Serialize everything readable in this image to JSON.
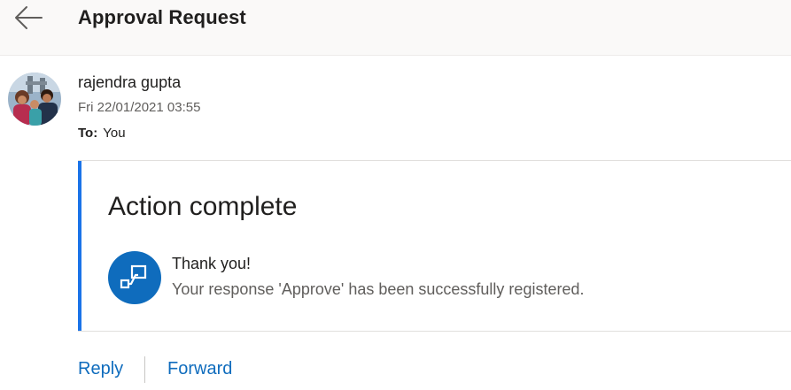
{
  "header": {
    "title": "Approval Request",
    "back_icon": "arrow-left-icon"
  },
  "message": {
    "sender_name": "rajendra gupta",
    "date": "Fri 22/01/2021 03:55",
    "to_label": "To:",
    "to_value": "You",
    "avatar_icon": "profile-photo"
  },
  "card": {
    "title": "Action complete",
    "icon": "power-automate-flow-icon",
    "thank_you": "Thank you!",
    "response_message": "Your response 'Approve' has been successfully registered.",
    "accent_color": "#1a73e8"
  },
  "actions": {
    "reply": "Reply",
    "forward": "Forward",
    "link_color": "#0f6cbd"
  }
}
